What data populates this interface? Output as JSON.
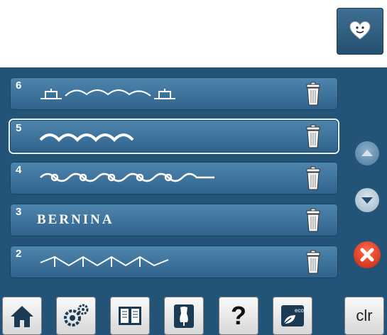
{
  "patterns": [
    {
      "number": "6"
    },
    {
      "number": "5",
      "selected": true
    },
    {
      "number": "4"
    },
    {
      "number": "3",
      "text": "BERNINA"
    },
    {
      "number": "2"
    }
  ],
  "toolbar": {
    "clr_label": "clr",
    "help_label": "?"
  },
  "colors": {
    "panel": "#235478",
    "row": "#4a80a8",
    "accent_close": "#e2361b",
    "pattern": "#ffffff"
  },
  "icons": [
    "heart-icon",
    "trash-icon",
    "arrow-up-icon",
    "arrow-down-icon",
    "close-icon",
    "home-icon",
    "settings-icon",
    "book-icon",
    "dress-form-icon",
    "help-icon",
    "eco-icon"
  ]
}
